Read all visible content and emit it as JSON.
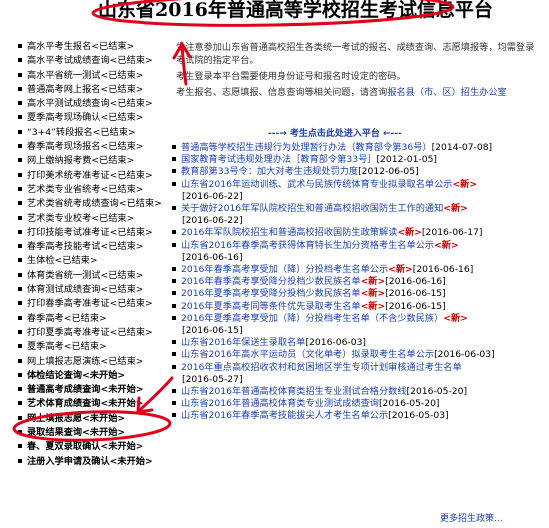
{
  "header": {
    "title": "山东省2016年普通高等学校招生考试信息平台"
  },
  "sidebar": {
    "items": [
      {
        "label": "高水平考生报名<已结束>",
        "bold": false
      },
      {
        "label": "高水平考试成绩查询<已结束>",
        "bold": false
      },
      {
        "label": "高水平省统一测试<已结束>",
        "bold": false
      },
      {
        "label": "普通高考网上报名<已结束>",
        "bold": false
      },
      {
        "label": "高水平测试成绩查询<已结束>",
        "bold": false
      },
      {
        "label": "夏季高考现场确认<已结束>",
        "bold": false
      },
      {
        "label": "“3+4”转段报名<已结束>",
        "bold": false
      },
      {
        "label": "春季高考现场报名<已结束>",
        "bold": false
      },
      {
        "label": "网上缴纳报考费<已结束>",
        "bold": false
      },
      {
        "label": "打印美术统考准考证<已结束>",
        "bold": false
      },
      {
        "label": "艺术类专业省统考<已结束>",
        "bold": false
      },
      {
        "label": "艺术类省统考成绩查询<已结束>",
        "bold": false
      },
      {
        "label": "艺术类专业校考<已结束>",
        "bold": false
      },
      {
        "label": "打印技能考试准考证<已结束>",
        "bold": false
      },
      {
        "label": "春季高考技能考试<已结束>",
        "bold": false
      },
      {
        "label": "生体检<已结束>",
        "bold": false
      },
      {
        "label": "体育类省统一测试<已结束>",
        "bold": false
      },
      {
        "label": "体育测试成绩查询<已结束>",
        "bold": false
      },
      {
        "label": "打印春季高考准考证<已结束>",
        "bold": false
      },
      {
        "label": "春季高考<已结束>",
        "bold": false
      },
      {
        "label": "打印夏季高考准考证<已结束>",
        "bold": false
      },
      {
        "label": "夏季高考<已结束>",
        "bold": false
      },
      {
        "label": "网上填报志愿演练<已结束>",
        "bold": false
      },
      {
        "label": "体检结论查询<未开始>",
        "bold": true
      },
      {
        "label": "普通高考成绩查询<未开始>",
        "bold": true
      },
      {
        "label": "艺术体育成绩查询<未开始>",
        "bold": true
      },
      {
        "label": "网上填报志愿<未开始>",
        "bold": true
      },
      {
        "label": "录取结果查询<未开始>",
        "bold": true
      },
      {
        "label": "春、夏双录取确认<未开始>",
        "bold": true
      },
      {
        "label": "注册入学申请及确认<未开始>",
        "bold": true
      }
    ]
  },
  "notice": {
    "line1": "生注意参加山东省普通高校招生各类统一考试的报名、成绩查询、志愿填报等，均需登录考试院的指定平台。",
    "line2": "考生登录本平台需要使用身份证号和报名时设定的密码。",
    "line3_prefix": "考生报名、志愿填报、信息查询等相关问题，请咨询",
    "line3_link": "报名县（市、区）招生办公室"
  },
  "click_here": "---→ 考生点击此处进入平台 ←---",
  "news": [
    {
      "text": "普通高等学校招生违规行为处理暂行办法（教育部令第36号）",
      "date": "[2014-07-08]",
      "new": false,
      "cont": null
    },
    {
      "text": "国家教育考试违规处理办法［教育部令第33号］",
      "date": "[2012-01-05]",
      "new": false,
      "cont": null
    },
    {
      "text": "教育部第33号令：加大对考生违规处罚力度",
      "date": "[2012-06-05]",
      "new": false,
      "cont": null
    },
    {
      "text": "山东省2016年运动训练、武术与民族传统体育专业拟录取名单公示",
      "date": "",
      "new": true,
      "cont": "[2016-06-22]"
    },
    {
      "text": "关于做好2016年军队院校招生和普通高校招收国防生工作的通知",
      "date": "",
      "new": true,
      "cont": "[2016-06-22]"
    },
    {
      "text": "2016年军队院校招生和普通高校招收国防生政策解读",
      "date": "[2016-06-17]",
      "new": true,
      "cont": null
    },
    {
      "text": "山东省2016年春季高考获得体育特长生加分资格考生名单公示",
      "date": "",
      "new": true,
      "cont": "[2016-06-16]"
    },
    {
      "text": "2016年春季高考享受加（降）分投档考生名单公示",
      "date": "[2016-06-16]",
      "new": true,
      "cont": null
    },
    {
      "text": "2016年春季高考享受降分投档少数民族名单",
      "date": "[2016-06-16]",
      "new": true,
      "cont": null
    },
    {
      "text": "2016年夏季高考享受降分投档少数民族名单",
      "date": "[2016-06-15]",
      "new": true,
      "cont": null
    },
    {
      "text": "2016年夏季高考同等条件优先录取考生名单",
      "date": "[2016-06-15]",
      "new": true,
      "cont": null
    },
    {
      "text": "2016年夏季高考享受加（降）分投档考生名单（不含少数民族）",
      "date": "",
      "new": true,
      "cont": "[2016-06-15]"
    },
    {
      "text": "山东省2016年保送生录取名单",
      "date": "[2016-06-03]",
      "new": false,
      "cont": null
    },
    {
      "text": "山东省2016年高水平运动员（文化单考）拟录取考生名单公示",
      "date": "[2016-06-03]",
      "new": false,
      "cont": null
    },
    {
      "text": "2016年重点高校招收农村和贫困地区学生专项计划审核通过考生名单",
      "date": "",
      "new": false,
      "cont": "[2016-05-27]"
    },
    {
      "text": "山东省2016年普通高校体育类招生专业测试合格分数线",
      "date": "[2016-05-20]",
      "new": false,
      "cont": null
    },
    {
      "text": "山东省2016年普通高校体育类专业测试成绩查询",
      "date": "[2016-05-20]",
      "new": false,
      "cont": null
    },
    {
      "text": "山东省2016年春季高考技能拔尖人才考生名单公示",
      "date": "[2016-05-03]",
      "new": false,
      "cont": null
    }
  ],
  "more_link": "更多招生政策...",
  "colors": {
    "link": "#1a3fb5",
    "new_tag": "#cc0000",
    "annotation": "#e0001a"
  },
  "new_tag_label": "<新>"
}
